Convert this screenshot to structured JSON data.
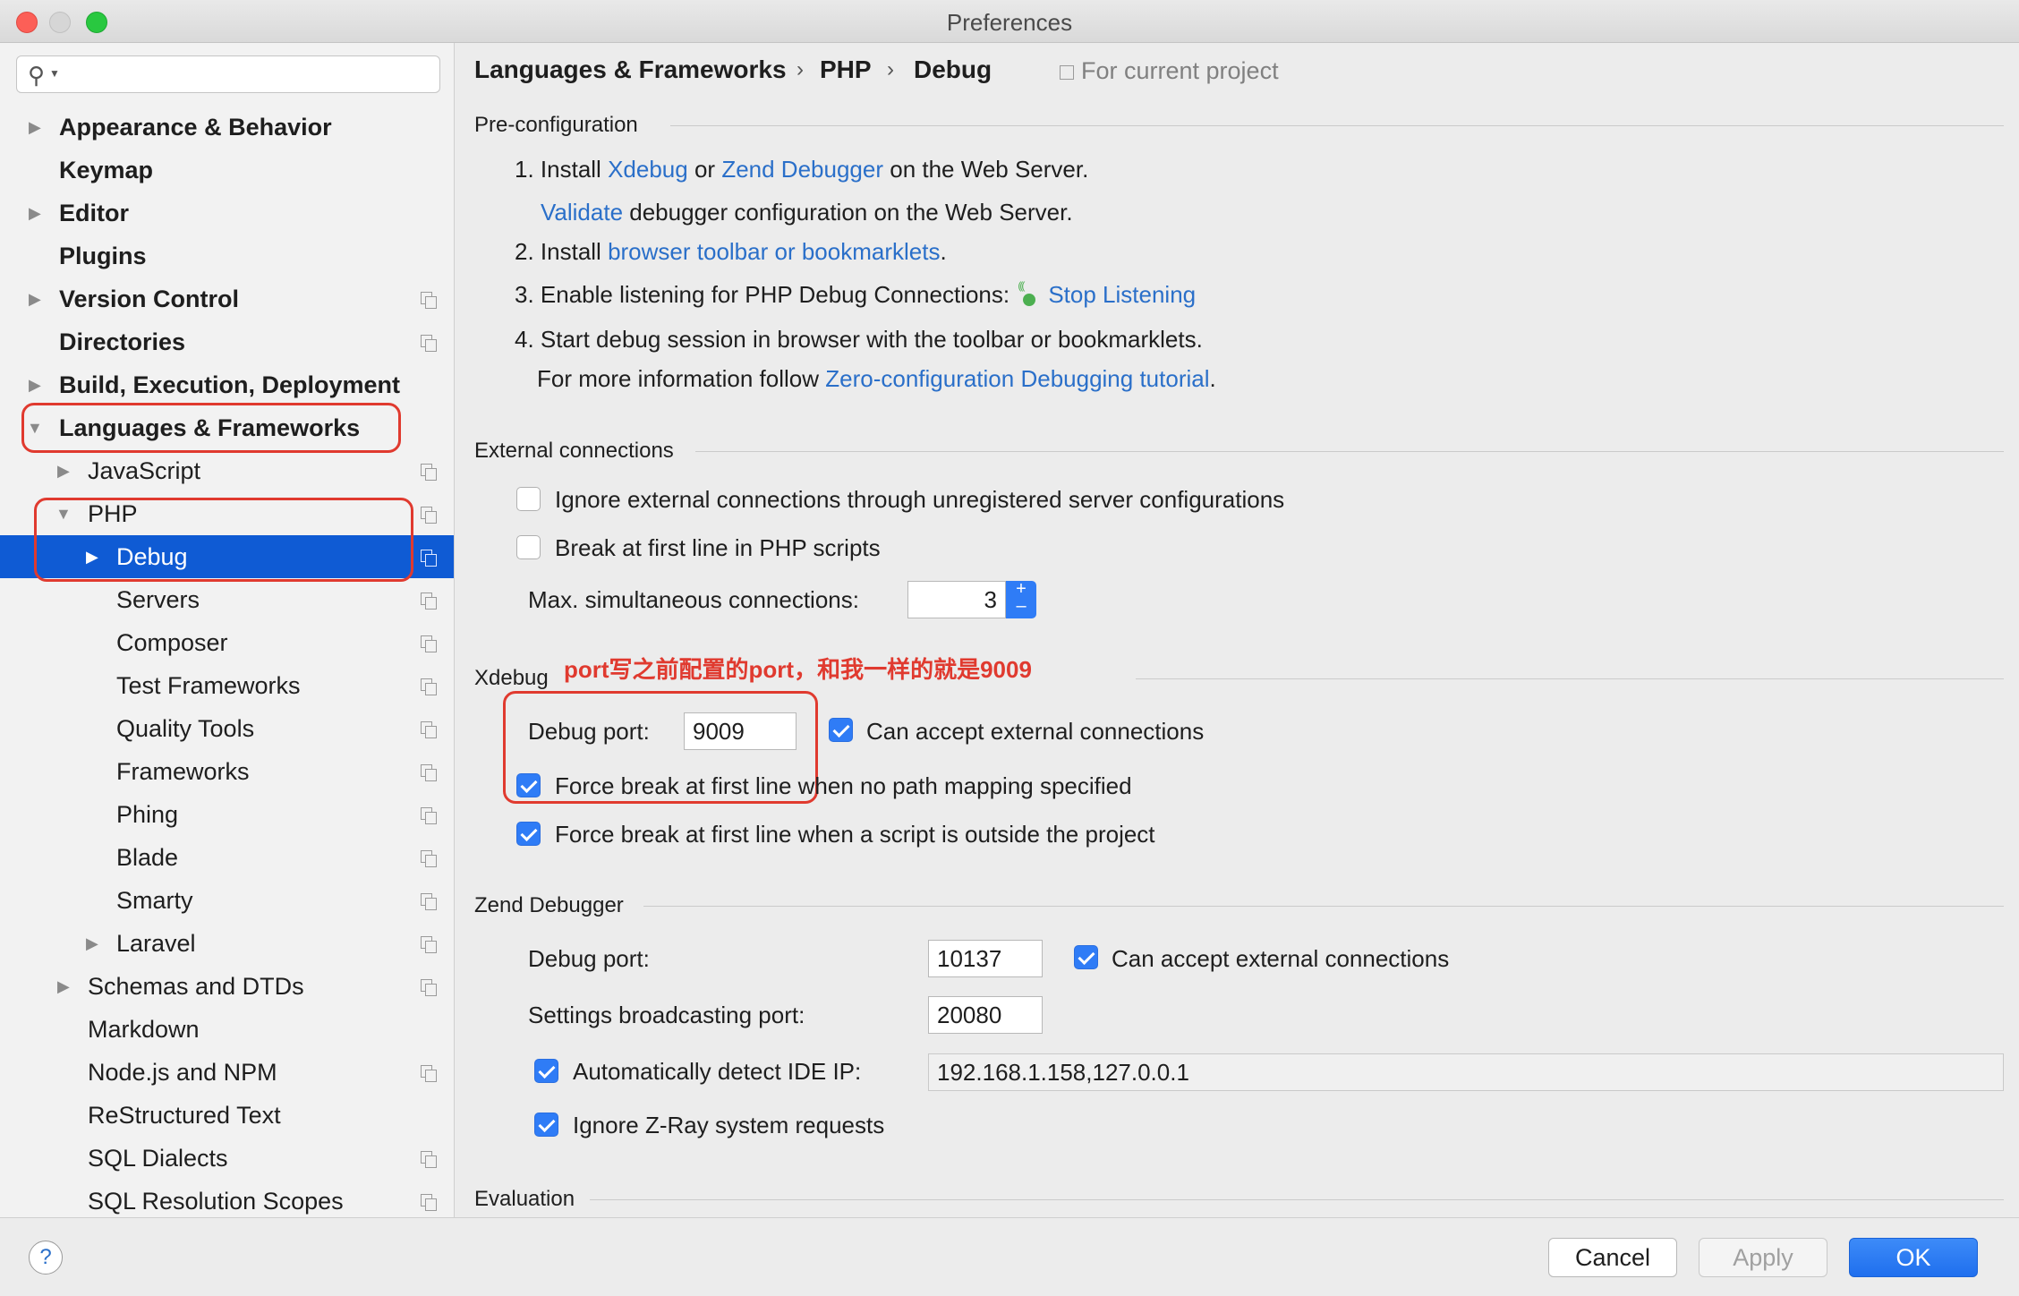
{
  "window": {
    "title": "Preferences"
  },
  "search": {
    "placeholder": ""
  },
  "sidebar": {
    "items": [
      {
        "label": "Appearance & Behavior"
      },
      {
        "label": "Keymap"
      },
      {
        "label": "Editor"
      },
      {
        "label": "Plugins"
      },
      {
        "label": "Version Control"
      },
      {
        "label": "Directories"
      },
      {
        "label": "Build, Execution, Deployment"
      },
      {
        "label": "Languages & Frameworks"
      },
      {
        "label": "JavaScript"
      },
      {
        "label": "PHP"
      },
      {
        "label": "Debug"
      },
      {
        "label": "Servers"
      },
      {
        "label": "Composer"
      },
      {
        "label": "Test Frameworks"
      },
      {
        "label": "Quality Tools"
      },
      {
        "label": "Frameworks"
      },
      {
        "label": "Phing"
      },
      {
        "label": "Blade"
      },
      {
        "label": "Smarty"
      },
      {
        "label": "Laravel"
      },
      {
        "label": "Schemas and DTDs"
      },
      {
        "label": "Markdown"
      },
      {
        "label": "Node.js and NPM"
      },
      {
        "label": "ReStructured Text"
      },
      {
        "label": "SQL Dialects"
      },
      {
        "label": "SQL Resolution Scopes"
      }
    ]
  },
  "breadcrumb": {
    "items": [
      "Languages & Frameworks",
      "PHP",
      "Debug"
    ],
    "separator": "›",
    "scope": "For current project"
  },
  "preconfig": {
    "title": "Pre-configuration",
    "step1_prefix": "1. Install",
    "xdebug_link": "Xdebug",
    "or": "or",
    "zend_link": "Zend Debugger",
    "step1_suffix": "on the Web Server.",
    "validate_link": "Validate",
    "validate_suffix": "debugger configuration on the Web Server.",
    "step2_prefix": "2. Install",
    "toolbar_link": "browser toolbar or bookmarklets",
    "step2_suffix": ".",
    "step3": "3. Enable listening for PHP Debug Connections:",
    "stop_link": "Stop Listening",
    "step4": "4. Start debug session in browser with the toolbar or bookmarklets.",
    "more_prefix": "For more information follow",
    "tutorial_link": "Zero-configuration Debugging tutorial",
    "more_suffix": "."
  },
  "external": {
    "title": "External connections",
    "ignore_label": "Ignore external connections through unregistered server configurations",
    "break_label": "Break at first line in PHP scripts",
    "max_label": "Max. simultaneous connections:",
    "max_value": "3",
    "stepper": "+\n–"
  },
  "xdebug": {
    "title": "Xdebug",
    "annotation": "port写之前配置的port，和我一样的就是9009",
    "port_label": "Debug port:",
    "port_value": "9009",
    "accept_label": "Can accept external connections",
    "force_nopath_label": "Force break at first line when no path mapping specified",
    "force_outside_label": "Force break at first line when a script is outside the project"
  },
  "zend": {
    "title": "Zend Debugger",
    "port_label": "Debug port:",
    "port_value": "10137",
    "accept_label": "Can accept external connections",
    "broadcast_label": "Settings broadcasting port:",
    "broadcast_value": "20080",
    "detect_label": "Automatically detect IDE IP:",
    "detect_value": "192.168.1.158,127.0.0.1",
    "zray_label": "Ignore Z-Ray system requests"
  },
  "evaluation": {
    "title": "Evaluation"
  },
  "buttons": {
    "help": "?",
    "cancel": "Cancel",
    "apply": "Apply",
    "ok": "OK"
  },
  "colors": {
    "accent": "#2f7cf6",
    "selection": "#0f5bd4",
    "annotation": "#e03a2f",
    "link": "#2a6fc9"
  }
}
